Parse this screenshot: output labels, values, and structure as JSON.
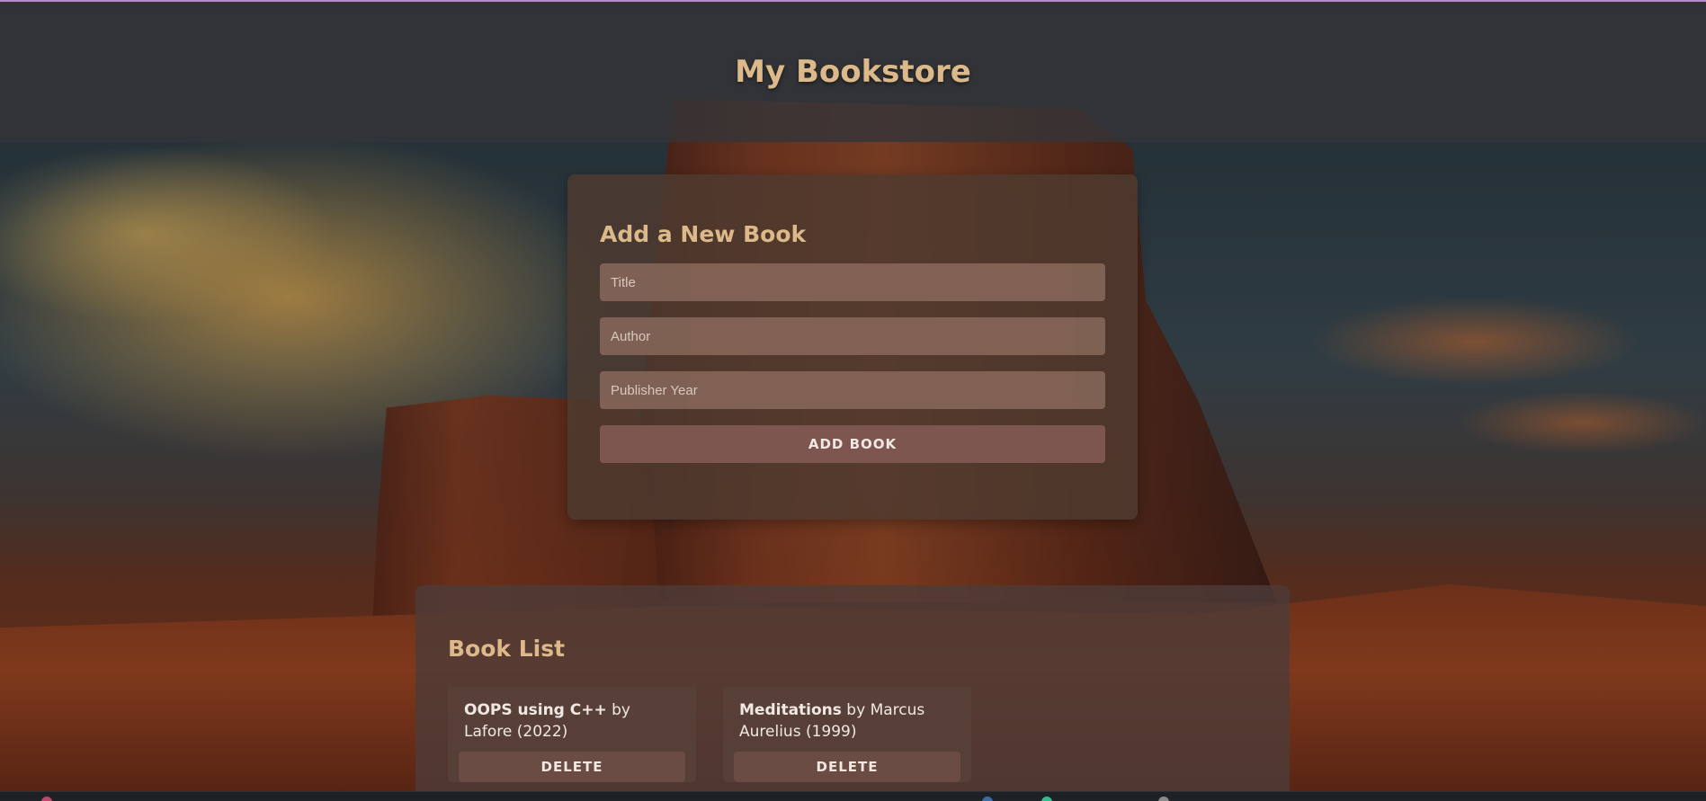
{
  "header": {
    "title": "My Bookstore"
  },
  "form": {
    "heading": "Add a New Book",
    "title_placeholder": "Title",
    "author_placeholder": "Author",
    "year_placeholder": "Publisher Year",
    "submit_label": "ADD BOOK"
  },
  "book_list": {
    "heading": "Book List",
    "items": [
      {
        "title": "OOPS using C++",
        "by": " by ",
        "author": "Lafore",
        "year": "(2022)",
        "delete_label": "DELETE"
      },
      {
        "title": "Meditations",
        "by": " by ",
        "author": "Marcus Aurelius",
        "year": "(1999)",
        "delete_label": "DELETE"
      }
    ]
  },
  "colors": {
    "heading": "#dcb98b",
    "accent_top_line": "#b48acb",
    "add_button": "#7e5650"
  }
}
